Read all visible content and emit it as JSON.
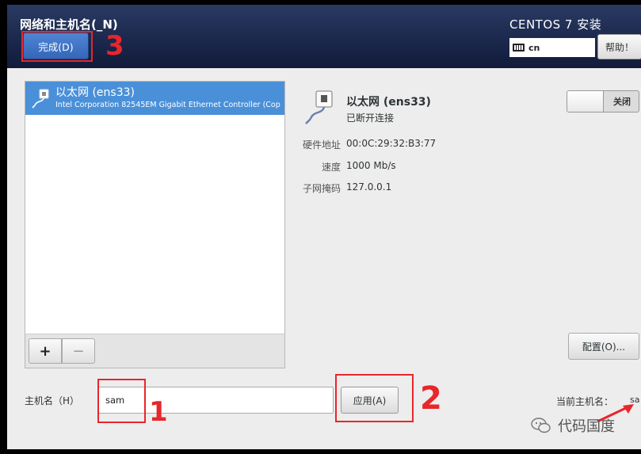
{
  "header": {
    "spoke_title": "网络和主机名(_N)",
    "done_label": "完成(D)",
    "product": "CENTOS 7 安装",
    "keyboard_layout": "cn",
    "help_label": "帮助！"
  },
  "devices": [
    {
      "name": "以太网 (ens33)",
      "description": "Intel Corporation 82545EM Gigabit Ethernet Controller (Cop"
    }
  ],
  "list_tools": {
    "add": "+",
    "remove": "−"
  },
  "detail": {
    "name": "以太网 (ens33)",
    "status": "已断开连接",
    "toggle_label": "关闭",
    "fields": [
      {
        "key": "硬件地址",
        "value": "00:0C:29:32:B3:77"
      },
      {
        "key": "速度",
        "value": "1000 Mb/s"
      },
      {
        "key": "子网掩码",
        "value": "127.0.0.1"
      }
    ],
    "configure_label": "配置(O)..."
  },
  "hostname": {
    "label": "主机名（H）",
    "value": "sam",
    "apply_label": "应用(A)",
    "current_label": "当前主机名：",
    "current_value": "sa"
  },
  "annotations": {
    "one": "1",
    "two": "2",
    "three": "3"
  },
  "watermark": "代码国度",
  "colors": {
    "accent": "#4a90d9",
    "header": "#182447",
    "annotation": "#e8262b"
  }
}
